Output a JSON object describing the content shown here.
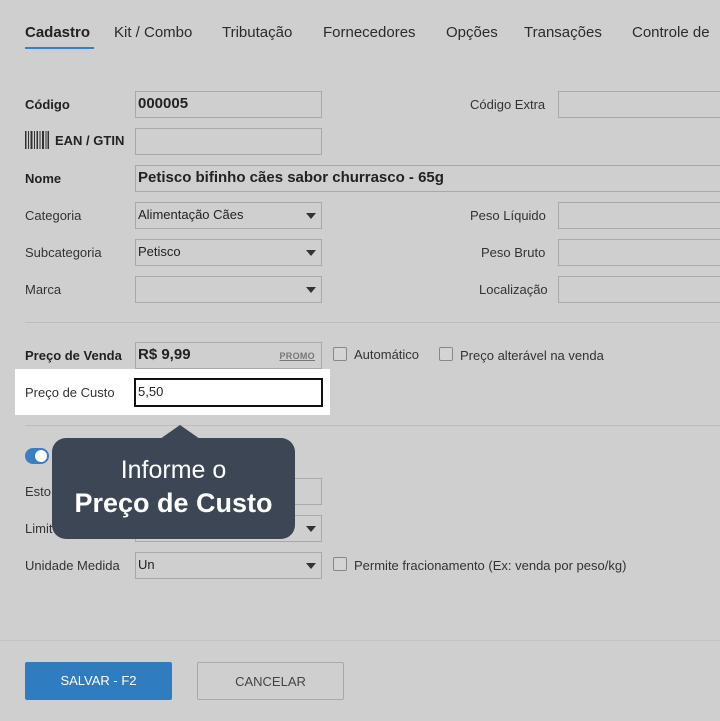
{
  "tabs": [
    {
      "label": "Cadastro"
    },
    {
      "label": "Kit / Combo"
    },
    {
      "label": "Tributação"
    },
    {
      "label": "Fornecedores"
    },
    {
      "label": "Opções"
    },
    {
      "label": "Transações"
    },
    {
      "label": "Controle de"
    }
  ],
  "form": {
    "codigo_label": "Código",
    "codigo_value": "000005",
    "codigo_extra_label": "Código Extra",
    "codigo_extra_value": "",
    "ean_label": "EAN / GTIN",
    "ean_value": "",
    "nome_label": "Nome",
    "nome_value": "Petisco bifinho cães sabor churrasco - 65g",
    "categoria_label": "Categoria",
    "categoria_value": "Alimentação Cães",
    "peso_liquido_label": "Peso Líquido",
    "peso_liquido_value": "",
    "subcategoria_label": "Subcategoria",
    "subcategoria_value": "Petisco",
    "peso_bruto_label": "Peso Bruto",
    "peso_bruto_value": "",
    "marca_label": "Marca",
    "marca_value": "",
    "localizacao_label": "Localização",
    "localizacao_value": "",
    "preco_venda_label": "Preço de Venda",
    "preco_venda_value": "R$ 9,99",
    "promo_label": "PROMO",
    "automatico_label": "Automático",
    "preco_alteravel_label": "Preço alterável na venda",
    "preco_custo_label": "Preço de Custo",
    "preco_custo_value": "5,50",
    "estoque_label_partial": "Esto",
    "limite_label_partial": "Limit",
    "unidade_label": "Unidade Medida",
    "unidade_value": "Un",
    "fracionamento_label": "Permite fracionamento (Ex: venda por peso/kg)"
  },
  "tooltip": {
    "line1": "Informe o",
    "line2": "Preço de Custo"
  },
  "footer": {
    "save_label": "SALVAR - F2",
    "cancel_label": "CANCELAR"
  },
  "colors": {
    "accent": "#2f7cc0",
    "tooltip_bg": "#3c4654"
  }
}
